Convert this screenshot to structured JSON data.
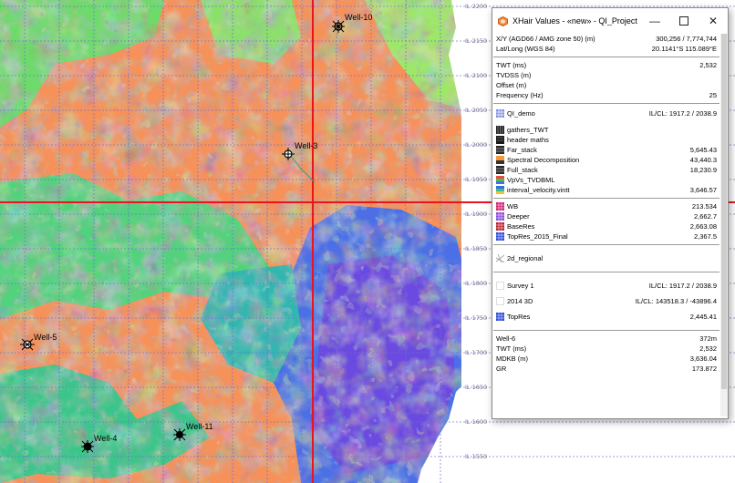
{
  "window": {
    "title": "XHair Values - «new» - QI_Project ...",
    "min_icon": "minimize-icon",
    "max_icon": "maximize-icon",
    "close_icon": "close-icon"
  },
  "map": {
    "il_labels": [
      "IL 2200",
      "IL 2150",
      "IL 2100",
      "IL 2050",
      "IL 2000",
      "IL 1950",
      "IL 1900",
      "IL 1850",
      "IL 1800",
      "IL 1750",
      "IL 1700",
      "IL 1650",
      "IL 1600",
      "IL 1550"
    ],
    "wells": [
      {
        "name": "Well-10",
        "symbol": "gas-well-icon"
      },
      {
        "name": "Well-3",
        "symbol": "dry-well-icon"
      },
      {
        "name": "Well-5",
        "symbol": "plugged-gas-well-icon"
      },
      {
        "name": "Well-4",
        "symbol": "oil-gas-well-icon"
      },
      {
        "name": "Well-11",
        "symbol": "oil-well-icon"
      }
    ],
    "colors": {
      "crosshair": "#e8141e",
      "grid": "#6f6fd6"
    }
  },
  "panel": {
    "coords": [
      {
        "label": "X/Y (AGD66 / AMG zone 50) (m)",
        "value": "300,256 / 7,774,744"
      },
      {
        "label": "Lat/Long (WGS 84)",
        "value": "20.1141°S 115.089°E"
      }
    ],
    "domain": [
      {
        "label": "TWT (ms)",
        "value": "2,532"
      },
      {
        "label": "TVDSS (m)",
        "value": ""
      },
      {
        "label": "Offset (m)",
        "value": ""
      },
      {
        "label": "Frequency (Hz)",
        "value": "25"
      }
    ],
    "qi_demo": {
      "label": "QI_demo",
      "value": "IL/CL: 1917.2 / 2038.9",
      "icon": "survey-grid-icon"
    },
    "volumes": [
      {
        "label": "gathers_TWT",
        "value": "",
        "icon": "gathers-icon"
      },
      {
        "label": "header maths",
        "value": "",
        "icon": "volume-icon"
      },
      {
        "label": "Far_stack",
        "value": "5,645.43",
        "icon": "seismic-volume-icon"
      },
      {
        "label": "Spectral Decomposition",
        "value": "43,440.3",
        "icon": "spectral-volume-icon"
      },
      {
        "label": "Full_stack",
        "value": "18,230.9",
        "icon": "seismic-volume-icon"
      },
      {
        "label": "VpVs_TVDBML",
        "value": "",
        "icon": "color-volume-icon"
      },
      {
        "label": "interval_velocity.vintt",
        "value": "3,646.57",
        "icon": "velocity-volume-icon"
      }
    ],
    "horizons": [
      {
        "label": "WB",
        "value": "213.534",
        "icon": "horizon-magenta-icon"
      },
      {
        "label": "Deeper",
        "value": "2,662.7",
        "icon": "horizon-purple-icon"
      },
      {
        "label": "BaseRes",
        "value": "2,663.08",
        "icon": "horizon-red-icon"
      },
      {
        "label": "TopRes_2015_Final",
        "value": "2,367.5",
        "icon": "horizon-blue-icon"
      }
    ],
    "regional": {
      "label": "2d_regional",
      "value": "",
      "icon": "2d-lines-icon"
    },
    "surveys": [
      {
        "label": "Survey 1",
        "value": "IL/CL: 1917.2 / 2038.9",
        "icon": "survey-outline-icon"
      },
      {
        "label": "2014 3D",
        "value": "IL/CL: 143518.3 / -43896.4",
        "icon": "survey-outline-icon"
      }
    ],
    "topres": {
      "label": "TopRes",
      "value": "2,445.41",
      "icon": "horizon-blue-icon"
    },
    "well": [
      {
        "label": "Well-6",
        "value": "372m"
      },
      {
        "label": "TWT (ms)",
        "value": "2,532"
      },
      {
        "label": "MDKB (m)",
        "value": "3,636.04"
      },
      {
        "label": "GR",
        "value": "173.872"
      }
    ]
  }
}
